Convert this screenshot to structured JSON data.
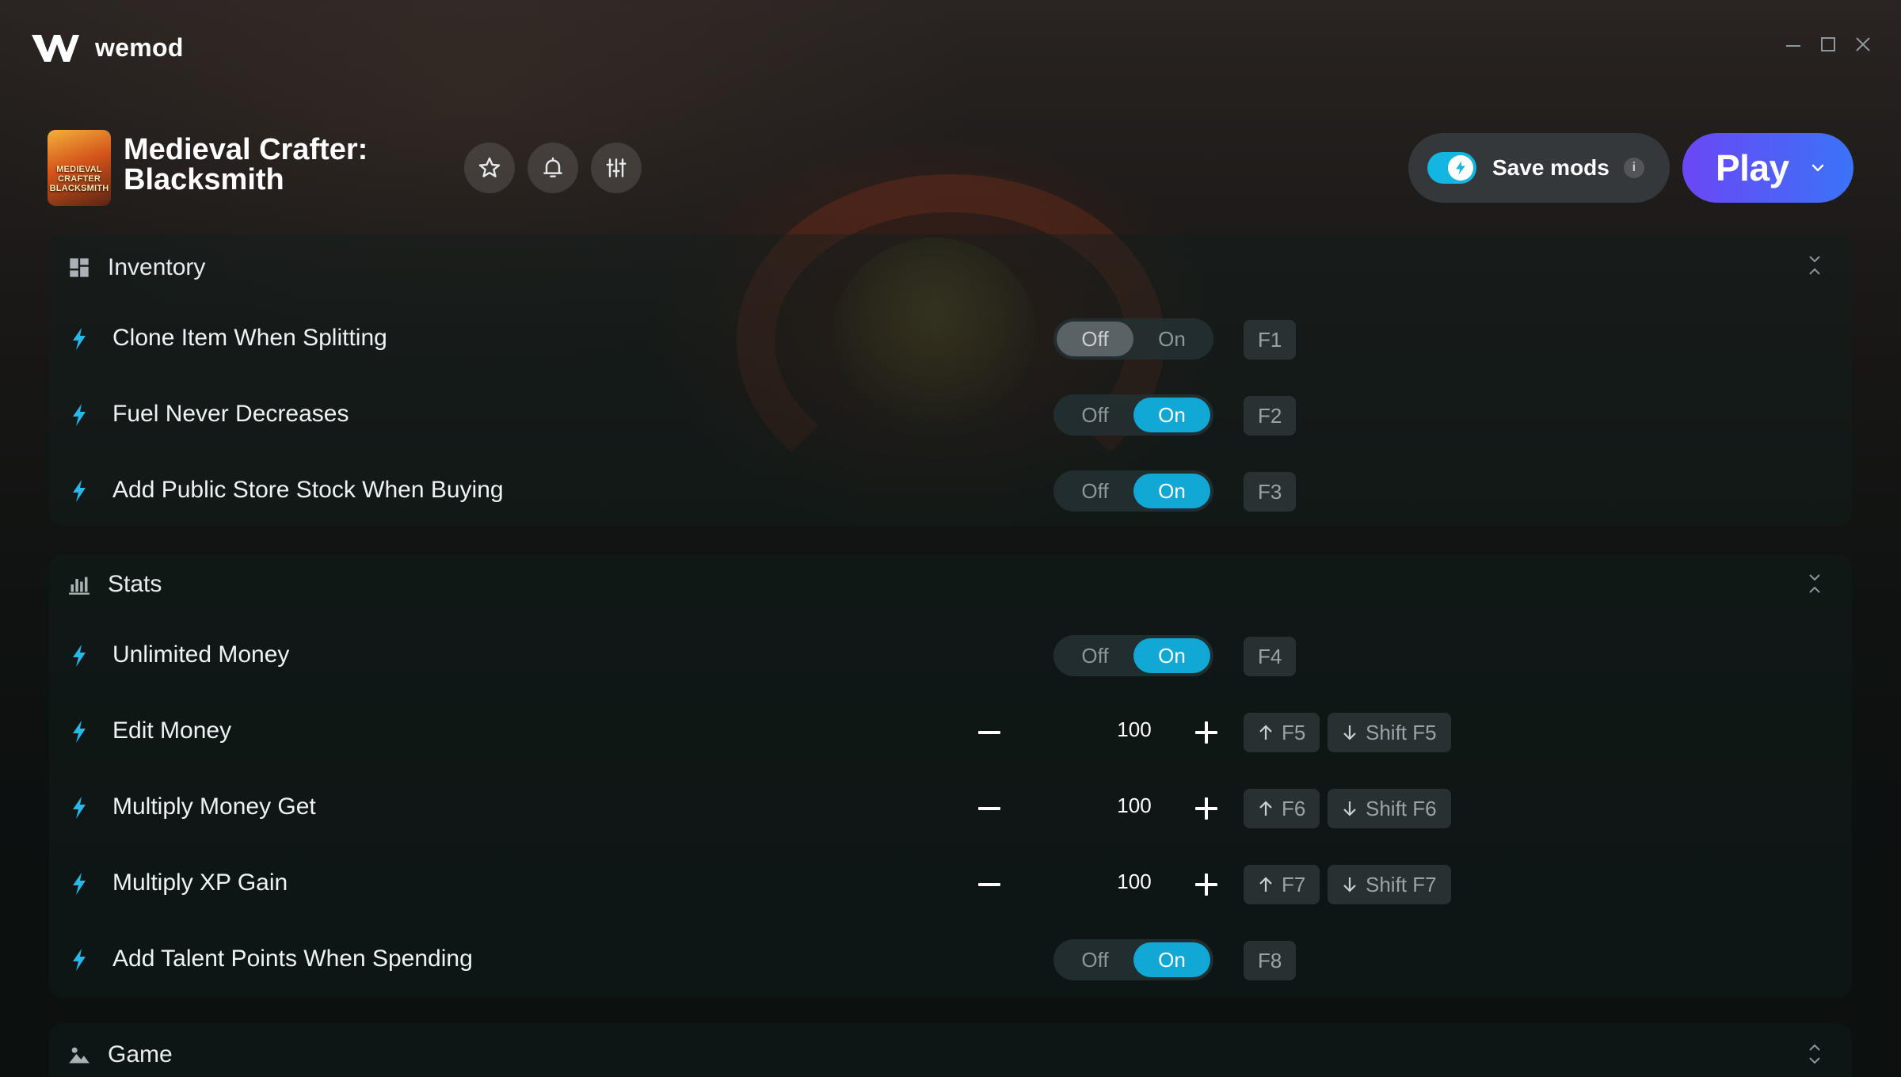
{
  "app": {
    "brand": "wemod"
  },
  "game": {
    "title_line1": "Medieval Crafter:",
    "title_line2": "Blacksmith",
    "cover_text": "MEDIEVAL CRAFTER BLACKSMITH"
  },
  "header": {
    "save_mods_label": "Save mods",
    "save_mods_enabled": true,
    "info_label": "i",
    "play_label": "Play"
  },
  "toggle_labels": {
    "off": "Off",
    "on": "On"
  },
  "sections": [
    {
      "label": "Inventory",
      "icon": "grid-icon",
      "rows": [
        {
          "name": "Clone Item When Splitting",
          "type": "toggle",
          "state": "off",
          "key": "F1"
        },
        {
          "name": "Fuel Never Decreases",
          "type": "toggle",
          "state": "on",
          "key": "F2"
        },
        {
          "name": "Add Public Store Stock When Buying",
          "type": "toggle",
          "state": "on",
          "key": "F3"
        }
      ]
    },
    {
      "label": "Stats",
      "icon": "bar-chart-icon",
      "rows": [
        {
          "name": "Unlimited Money",
          "type": "toggle",
          "state": "on",
          "key": "F4"
        },
        {
          "name": "Edit Money",
          "type": "stepper",
          "value": "100",
          "key_up": "F5",
          "key_down": "Shift F5"
        },
        {
          "name": "Multiply Money Get",
          "type": "stepper",
          "value": "100",
          "key_up": "F6",
          "key_down": "Shift F6"
        },
        {
          "name": "Multiply XP Gain",
          "type": "stepper",
          "value": "100",
          "key_up": "F7",
          "key_down": "Shift F7"
        },
        {
          "name": "Add Talent Points When Spending",
          "type": "toggle",
          "state": "on",
          "key": "F8"
        }
      ]
    },
    {
      "label": "Game",
      "icon": "landscape-icon",
      "rows": []
    }
  ],
  "colors": {
    "accent_on": "#11a8d6",
    "play_start": "#6b47f5",
    "play_end": "#3b73f7",
    "bolt": "#29b6e8"
  }
}
